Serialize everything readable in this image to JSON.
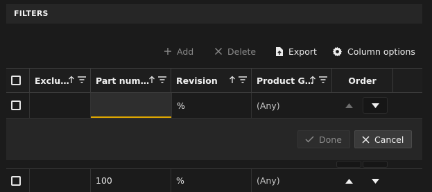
{
  "filters": {
    "title": "FILTERS"
  },
  "toolbar": {
    "add_label": "Add",
    "delete_label": "Delete",
    "export_label": "Export",
    "column_options_label": "Column options"
  },
  "columns": [
    {
      "label": "Exclu…",
      "sortable": true,
      "filterable": true
    },
    {
      "label": "Part num…",
      "sortable": true,
      "filterable": true
    },
    {
      "label": "Revision",
      "sortable": true,
      "filterable": true
    },
    {
      "label": "Product G…",
      "sortable": true,
      "filterable": true
    },
    {
      "label": "Order",
      "sortable": false,
      "filterable": false
    }
  ],
  "edit_row": {
    "exclude": "",
    "part_number": "",
    "revision": "%",
    "product_group": "(Any)"
  },
  "edit_panel": {
    "done_label": "Done",
    "cancel_label": "Cancel"
  },
  "rows": [
    {
      "exclude": "",
      "part_number": "100",
      "revision": "%",
      "product_group": "(Any)"
    }
  ],
  "colors": {
    "accent": "#e0a800",
    "background": "#1b1b1b",
    "panel": "#262626"
  },
  "icons": [
    "plus-icon",
    "close-icon",
    "export-icon",
    "gear-icon",
    "sort-up-icon",
    "filter-icon",
    "chevron-up-icon",
    "chevron-down-icon",
    "check-icon"
  ]
}
